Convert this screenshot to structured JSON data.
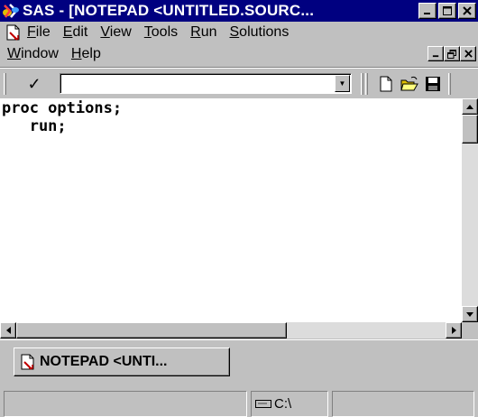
{
  "window": {
    "title": "SAS - [NOTEPAD <UNTITLED.SOURC...",
    "app_icon": "sas-logo-icon",
    "controls": [
      "minimize",
      "maximize",
      "close"
    ]
  },
  "menubar": {
    "items": [
      {
        "label": "File",
        "key": "F",
        "rest": "ile"
      },
      {
        "label": "Edit",
        "key": "E",
        "rest": "dit"
      },
      {
        "label": "View",
        "key": "V",
        "rest": "iew"
      },
      {
        "label": "Tools",
        "key": "T",
        "rest": "ools"
      },
      {
        "label": "Run",
        "key": "R",
        "rest": "un"
      },
      {
        "label": "Solutions",
        "key": "S",
        "rest": "olutions"
      },
      {
        "label": "Window",
        "key": "W",
        "rest": "indow"
      },
      {
        "label": "Help",
        "key": "H",
        "rest": "elp"
      }
    ]
  },
  "toolbar": {
    "check_glyph": "✓",
    "command_value": "",
    "dropdown_glyph": "▼",
    "icons": [
      "new-document-icon",
      "open-folder-icon",
      "save-disk-icon"
    ]
  },
  "editor": {
    "lines": [
      "proc options;",
      "   run;"
    ]
  },
  "taskbar": {
    "item_label": "NOTEPAD <UNTI..."
  },
  "statusbar": {
    "path": "C:\\"
  },
  "colors": {
    "titlebar": "#000080",
    "face": "#c0c0c0",
    "editor_bg": "#ffffff"
  }
}
